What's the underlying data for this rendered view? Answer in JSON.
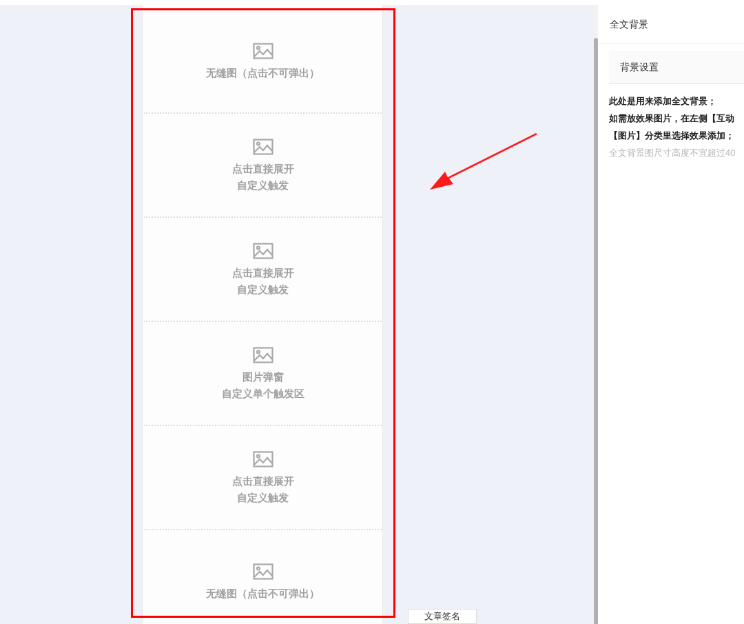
{
  "canvas": {
    "cells": [
      {
        "lines": [
          "无缝图（点击不可弹出）"
        ]
      },
      {
        "lines": [
          "点击直接展开",
          "自定义触发"
        ]
      },
      {
        "lines": [
          "点击直接展开",
          "自定义触发"
        ]
      },
      {
        "lines": [
          "图片弹窗",
          "自定义单个触发区"
        ]
      },
      {
        "lines": [
          "点击直接展开",
          "自定义触发"
        ]
      },
      {
        "lines": [
          "无缝图（点击不可弹出）"
        ]
      }
    ],
    "signature_button": "文章签名"
  },
  "panel": {
    "title": "全文背景",
    "section": "背景设置",
    "notes": [
      {
        "text": "此处是用来添加全文背景；",
        "kind": "strong"
      },
      {
        "text": "如需放效果图片，在左侧【互动",
        "kind": "strong"
      },
      {
        "text": "【图片】分类里选择效果添加；",
        "kind": "strong"
      },
      {
        "text": "全文背景图尺寸高度不宜超过40",
        "kind": "hint"
      }
    ]
  }
}
